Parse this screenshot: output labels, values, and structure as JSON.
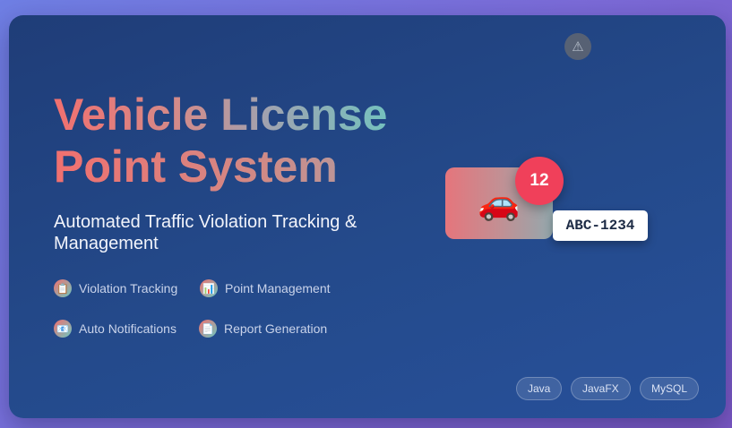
{
  "title": {
    "line1": "Vehicle License",
    "line2": "Point System"
  },
  "subtitle": "Automated Traffic Violation Tracking & Management",
  "features": [
    {
      "icon": "clipboard-icon",
      "glyph": "📋",
      "label": "Violation Tracking"
    },
    {
      "icon": "bar-chart-icon",
      "glyph": "📊",
      "label": "Point Management"
    },
    {
      "icon": "email-icon",
      "glyph": "📧",
      "label": "Auto Notifications"
    },
    {
      "icon": "document-icon",
      "glyph": "📄",
      "label": "Report Generation"
    }
  ],
  "illustration": {
    "warning_glyph": "⚠",
    "car_glyph": "🚗",
    "points_badge": "12",
    "plate": "ABC-1234"
  },
  "tech_stack": [
    "Java",
    "JavaFX",
    "MySQL"
  ],
  "colors": {
    "background_start": "#6f7fe4",
    "card": "#244a8b",
    "accent_red": "#f1706f",
    "accent_teal": "#6cc7c1",
    "badge": "#f0405a"
  }
}
